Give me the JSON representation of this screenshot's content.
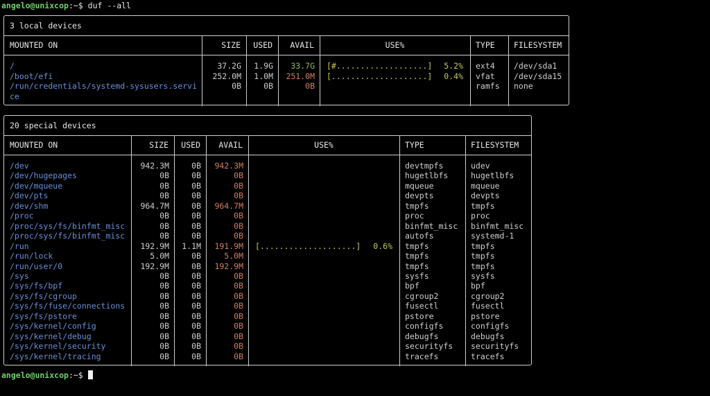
{
  "terminal": {
    "user_host": "angelo@unixcop",
    "path": ":~",
    "prompt_symbol": "$ ",
    "command": "duf --all"
  },
  "local": {
    "title": "3 local devices",
    "headers": [
      "MOUNTED ON",
      "SIZE",
      "USED",
      "AVAIL",
      "USE%",
      "TYPE",
      "FILESYSTEM"
    ],
    "rows": [
      {
        "mount": "/",
        "size": "37.2G",
        "used": "1.9G",
        "avail": "33.7G",
        "avail_state": "ok",
        "bar": "[#...................]",
        "pct": "5.2%",
        "type": "ext4",
        "fs": "/dev/sda1"
      },
      {
        "mount": "/boot/efi",
        "size": "252.0M",
        "used": "1.0M",
        "avail": "251.0M",
        "avail_state": "warn",
        "bar": "[....................]",
        "pct": "0.4%",
        "type": "vfat",
        "fs": "/dev/sda15"
      },
      {
        "mount": "/run/credentials/systemd-sysusers.servi",
        "size": "0B",
        "used": "0B",
        "avail": "0B",
        "avail_state": "warn",
        "bar": "",
        "pct": "",
        "type": "ramfs",
        "fs": "none"
      }
    ],
    "mount_wrap": "ce"
  },
  "special": {
    "title": "20 special devices",
    "headers": [
      "MOUNTED ON",
      "SIZE",
      "USED",
      "AVAIL",
      "USE%",
      "TYPE",
      "FILESYSTEM"
    ],
    "rows": [
      {
        "mount": "/dev",
        "size": "942.3M",
        "used": "0B",
        "avail": "942.3M",
        "bar": "",
        "pct": "",
        "type": "devtmpfs",
        "fs": "udev"
      },
      {
        "mount": "/dev/hugepages",
        "size": "0B",
        "used": "0B",
        "avail": "0B",
        "bar": "",
        "pct": "",
        "type": "hugetlbfs",
        "fs": "hugetlbfs"
      },
      {
        "mount": "/dev/mqueue",
        "size": "0B",
        "used": "0B",
        "avail": "0B",
        "bar": "",
        "pct": "",
        "type": "mqueue",
        "fs": "mqueue"
      },
      {
        "mount": "/dev/pts",
        "size": "0B",
        "used": "0B",
        "avail": "0B",
        "bar": "",
        "pct": "",
        "type": "devpts",
        "fs": "devpts"
      },
      {
        "mount": "/dev/shm",
        "size": "964.7M",
        "used": "0B",
        "avail": "964.7M",
        "bar": "",
        "pct": "",
        "type": "tmpfs",
        "fs": "tmpfs"
      },
      {
        "mount": "/proc",
        "size": "0B",
        "used": "0B",
        "avail": "0B",
        "bar": "",
        "pct": "",
        "type": "proc",
        "fs": "proc"
      },
      {
        "mount": "/proc/sys/fs/binfmt_misc",
        "size": "0B",
        "used": "0B",
        "avail": "0B",
        "bar": "",
        "pct": "",
        "type": "binfmt_misc",
        "fs": "binfmt_misc"
      },
      {
        "mount": "/proc/sys/fs/binfmt_misc",
        "size": "0B",
        "used": "0B",
        "avail": "0B",
        "bar": "",
        "pct": "",
        "type": "autofs",
        "fs": "systemd-1"
      },
      {
        "mount": "/run",
        "size": "192.9M",
        "used": "1.1M",
        "avail": "191.9M",
        "bar": "[....................]",
        "pct": "0.6%",
        "type": "tmpfs",
        "fs": "tmpfs"
      },
      {
        "mount": "/run/lock",
        "size": "5.0M",
        "used": "0B",
        "avail": "5.0M",
        "bar": "",
        "pct": "",
        "type": "tmpfs",
        "fs": "tmpfs"
      },
      {
        "mount": "/run/user/0",
        "size": "192.9M",
        "used": "0B",
        "avail": "192.9M",
        "bar": "",
        "pct": "",
        "type": "tmpfs",
        "fs": "tmpfs"
      },
      {
        "mount": "/sys",
        "size": "0B",
        "used": "0B",
        "avail": "0B",
        "bar": "",
        "pct": "",
        "type": "sysfs",
        "fs": "sysfs"
      },
      {
        "mount": "/sys/fs/bpf",
        "size": "0B",
        "used": "0B",
        "avail": "0B",
        "bar": "",
        "pct": "",
        "type": "bpf",
        "fs": "bpf"
      },
      {
        "mount": "/sys/fs/cgroup",
        "size": "0B",
        "used": "0B",
        "avail": "0B",
        "bar": "",
        "pct": "",
        "type": "cgroup2",
        "fs": "cgroup2"
      },
      {
        "mount": "/sys/fs/fuse/connections",
        "size": "0B",
        "used": "0B",
        "avail": "0B",
        "bar": "",
        "pct": "",
        "type": "fusectl",
        "fs": "fusectl"
      },
      {
        "mount": "/sys/fs/pstore",
        "size": "0B",
        "used": "0B",
        "avail": "0B",
        "bar": "",
        "pct": "",
        "type": "pstore",
        "fs": "pstore"
      },
      {
        "mount": "/sys/kernel/config",
        "size": "0B",
        "used": "0B",
        "avail": "0B",
        "bar": "",
        "pct": "",
        "type": "configfs",
        "fs": "configfs"
      },
      {
        "mount": "/sys/kernel/debug",
        "size": "0B",
        "used": "0B",
        "avail": "0B",
        "bar": "",
        "pct": "",
        "type": "debugfs",
        "fs": "debugfs"
      },
      {
        "mount": "/sys/kernel/security",
        "size": "0B",
        "used": "0B",
        "avail": "0B",
        "bar": "",
        "pct": "",
        "type": "securityfs",
        "fs": "securityfs"
      },
      {
        "mount": "/sys/kernel/tracing",
        "size": "0B",
        "used": "0B",
        "avail": "0B",
        "bar": "",
        "pct": "",
        "type": "tracefs",
        "fs": "tracefs"
      }
    ]
  },
  "colors": {
    "mount": "#6a8fd8",
    "avail_ok": "#8fbf5a",
    "avail_warn": "#d08060",
    "bar": "#c8c85a",
    "user": "#6ed06e"
  }
}
